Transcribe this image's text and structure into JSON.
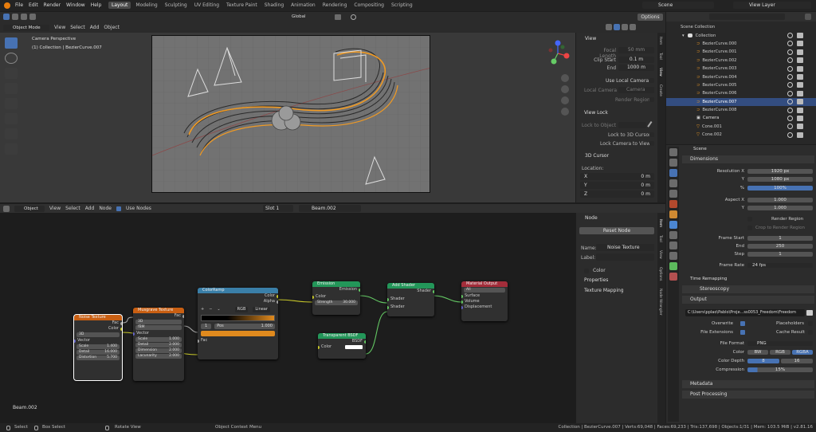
{
  "topbar": {
    "menus": [
      "File",
      "Edit",
      "Render",
      "Window",
      "Help"
    ],
    "workspaces": [
      "Layout",
      "Modeling",
      "Sculpting",
      "UV Editing",
      "Texture Paint",
      "Shading",
      "Animation",
      "Rendering",
      "Compositing",
      "Scripting"
    ],
    "active_workspace": "Layout",
    "scene": "Scene",
    "view_layer": "View Layer"
  },
  "viewport": {
    "mode": "Object Mode",
    "menus": [
      "View",
      "Select",
      "Add",
      "Object"
    ],
    "transform": "Global",
    "options": "Options",
    "title": "Camera Perspective",
    "subtitle": "(1) Collection | BezierCurve.007"
  },
  "npanel": {
    "tabs": [
      "Item",
      "Tool",
      "View",
      "Create",
      "Relations",
      "Quick Lights",
      "MACHIN3",
      "AutoRig",
      "MakeHu",
      "MakeTar"
    ],
    "view_header": "View",
    "focal_label": "Focal Length",
    "focal_value": "50 mm",
    "clip_start_label": "Clip Start",
    "clip_start_value": "0.1 m",
    "end_label": "End",
    "end_value": "1000 m",
    "use_local_camera": "Use Local Camera",
    "local_camera_label": "Local Camera",
    "local_camera_value": "Camera",
    "render_region": "Render Region",
    "view_lock": "View Lock",
    "lock_to_object": "Lock to Object",
    "lock_to_3d_cursor": "Lock to 3D Cursor",
    "lock_camera_to_view": "Lock Camera to View",
    "cursor_header": "3D Cursor",
    "location": "Location:",
    "x": "X",
    "y": "Y",
    "z": "Z",
    "zero": "0 m"
  },
  "nodeeditor": {
    "type": "Object",
    "menus": [
      "View",
      "Select",
      "Add",
      "Node"
    ],
    "use_nodes": "Use Nodes",
    "slot": "Slot 1",
    "material": "Beam.002",
    "footer_label": "Beam.002"
  },
  "nodes": {
    "noise": {
      "title": "Noise Texture",
      "fac": "Fac",
      "color": "Color",
      "dim": "3D",
      "vector": "Vector",
      "scale": "Scale",
      "scale_v": "1.400",
      "detail": "Detail",
      "detail_v": "16.000",
      "distortion": "Distortion",
      "distortion_v": "5.700"
    },
    "musgrave": {
      "title": "Musgrave Texture",
      "fac": "Fac",
      "dim": "3D",
      "type": "fBM",
      "vector": "Vector",
      "scale": "Scale",
      "scale_v": "1.000",
      "detail": "Detail",
      "detail_v": "2.000",
      "dimension": "Dimension",
      "dimension_v": "2.000",
      "lacunarity": "Lacunarity",
      "lacunarity_v": "2.000"
    },
    "colorramp": {
      "title": "ColorRamp",
      "color": "Color",
      "alpha": "Alpha",
      "mode": "RGB",
      "interp": "Linear",
      "index": "1",
      "pos": "Pos",
      "pos_v": "1.000",
      "fac": "Fac"
    },
    "emission": {
      "title": "Emission",
      "out": "Emission",
      "color": "Color",
      "strength": "Strength",
      "strength_v": "30.000"
    },
    "transparent": {
      "title": "Transparent BSDF",
      "out": "BSDF",
      "color": "Color"
    },
    "addshader": {
      "title": "Add Shader",
      "out": "Shader",
      "in1": "Shader",
      "in2": "Shader"
    },
    "output": {
      "title": "Material Output",
      "target": "All",
      "surface": "Surface",
      "volume": "Volume",
      "displacement": "Displacement"
    }
  },
  "nodepanel": {
    "tabs": [
      "Item",
      "Tool",
      "View",
      "Options",
      "Node Wrangler"
    ],
    "node_header": "Node",
    "reset": "Reset Node",
    "name_label": "Name:",
    "name_value": "Noise Texture",
    "label_label": "Label:",
    "color": "Color",
    "properties": "Properties",
    "texture_mapping": "Texture Mapping"
  },
  "outliner": {
    "root": "Scene Collection",
    "items": [
      "Collection",
      "BezierCurve.000",
      "BezierCurve.001",
      "BezierCurve.002",
      "BezierCurve.003",
      "BezierCurve.004",
      "BezierCurve.005",
      "BezierCurve.006",
      "BezierCurve.007",
      "BezierCurve.008",
      "Camera",
      "Cone.001",
      "Cone.002"
    ],
    "selected": "BezierCurve.007"
  },
  "properties": {
    "scene": "Scene",
    "dimensions": "Dimensions",
    "res_x_label": "Resolution X",
    "res_x": "1920 px",
    "y_label": "Y",
    "res_y": "1080 px",
    "pct_label": "%",
    "pct": "100%",
    "aspect_x_label": "Aspect X",
    "aspect_x": "1.000",
    "aspect_y": "1.000",
    "render_region": "Render Region",
    "crop": "Crop to Render Region",
    "frame_start_label": "Frame Start",
    "frame_start": "1",
    "end_label": "End",
    "frame_end": "250",
    "step_label": "Step",
    "step": "1",
    "frame_rate_label": "Frame Rate",
    "frame_rate": "24 fps",
    "time_remapping": "Time Remapping",
    "stereoscopy": "Stereoscopy",
    "output": "Output",
    "path": "C:\\Users\\pplao\\Pablo\\Proje...ss0053_Freedom\\Freedom",
    "overwrite": "Overwrite",
    "placeholders": "Placeholders",
    "file_extensions": "File Extensions",
    "cache_result": "Cache Result",
    "file_format_label": "File Format",
    "file_format": "PNG",
    "color_label": "Color",
    "bw": "BW",
    "rgb": "RGB",
    "rgba": "RGBA",
    "color_depth_label": "Color Depth",
    "d8": "8",
    "d16": "16",
    "compression_label": "Compression",
    "compression": "15%",
    "metadata": "Metadata",
    "post_processing": "Post Processing"
  },
  "status": {
    "select": "Select",
    "box_select": "Box Select",
    "rotate_view": "Rotate View",
    "context_menu": "Object Context Menu",
    "stats": "Collection | BezierCurve.007 | Verts:69,048 | Faces:69,233 | Tris:137,698 | Objects:1/31 | Mem: 103.5 MiB | v2.81.16"
  },
  "colors": {
    "accent": "#4772b3",
    "orange": "#e08a1e",
    "selected_row": "#334d80"
  }
}
